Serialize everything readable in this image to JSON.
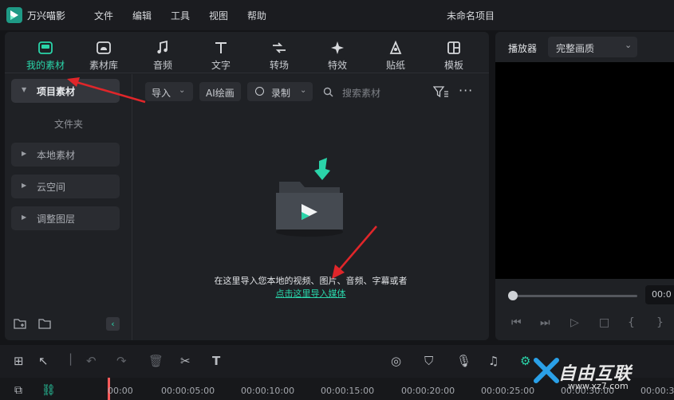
{
  "titlebar": {
    "app_name": "万兴喵影",
    "menus": [
      "文件",
      "编辑",
      "工具",
      "视图",
      "帮助"
    ],
    "project_title": "未命名项目"
  },
  "tabs": [
    {
      "label": "我的素材",
      "icon": "media-icon",
      "active": true
    },
    {
      "label": "素材库",
      "icon": "stock-cloud-icon",
      "active": false
    },
    {
      "label": "音频",
      "icon": "music-note-icon",
      "active": false
    },
    {
      "label": "文字",
      "icon": "text-icon",
      "active": false
    },
    {
      "label": "转场",
      "icon": "transition-icon",
      "active": false
    },
    {
      "label": "特效",
      "icon": "effects-icon",
      "active": false
    },
    {
      "label": "贴纸",
      "icon": "sticker-icon",
      "active": false
    },
    {
      "label": "模板",
      "icon": "template-icon",
      "active": false
    }
  ],
  "sidebar": {
    "project_media": "项目素材",
    "folder": "文件夹",
    "items": [
      "本地素材",
      "云空间",
      "调整图层"
    ]
  },
  "toolbar": {
    "import_label": "导入",
    "ai_draw_label": "AI绘画",
    "record_label": "录制",
    "search_placeholder": "搜索素材"
  },
  "empty_state": {
    "text": "在这里导入您本地的视频、图片、音频、字幕或者",
    "link": "点击这里导入媒体"
  },
  "player": {
    "label": "播放器",
    "quality": "完整画质",
    "time": "00:0"
  },
  "timeline": {
    "ticks": [
      "00:00",
      "00:00:05:00",
      "00:00:10:00",
      "00:00:15:00",
      "00:00:20:00",
      "00:00:25:00",
      "00:00:30:00",
      "00:00:3"
    ]
  },
  "watermark": {
    "text": "自由互联",
    "sub": "www.xz7.com"
  },
  "colors": {
    "accent": "#2ad4a9",
    "annotation": "#e0262a",
    "playhead": "#ff5a5a"
  }
}
